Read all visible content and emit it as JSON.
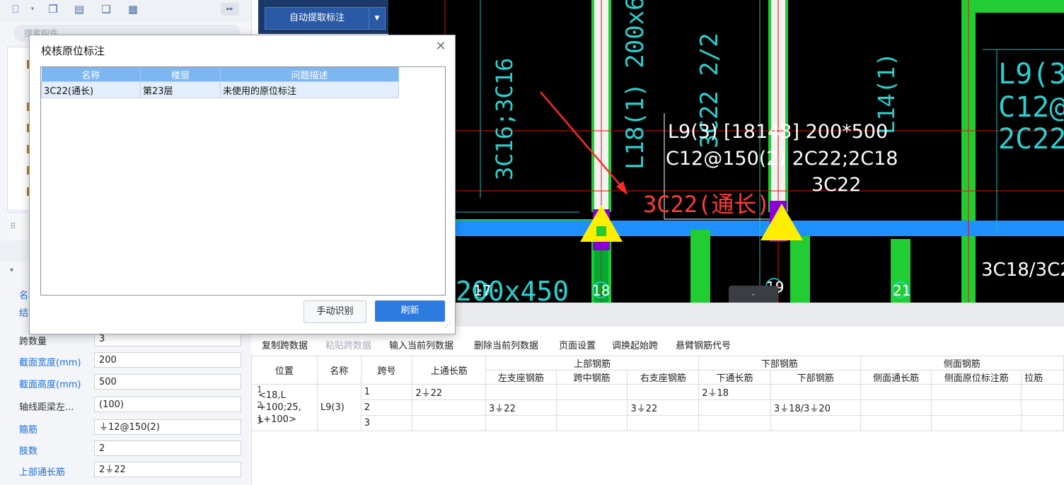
{
  "toolbar": {
    "icons": [
      "new-icon",
      "copy-icon",
      "delete-icon",
      "duplicate-icon",
      "layer-copy-icon",
      "more-icon"
    ]
  },
  "search": {
    "placeholder": "搜索构件"
  },
  "mid": {
    "auto_button": "自动提取标注"
  },
  "properties": {
    "rows": [
      {
        "label": "名称",
        "value": "",
        "blue": true
      },
      {
        "label": "结构类别",
        "value": "",
        "blue": true
      },
      {
        "label": "跨数量",
        "value": "3",
        "blue": false
      },
      {
        "label": "截面宽度(mm)",
        "value": "200",
        "blue": true
      },
      {
        "label": "截面高度(mm)",
        "value": "500",
        "blue": true
      },
      {
        "label": "轴线距梁左...",
        "value": "(100)",
        "blue": false
      },
      {
        "label": "箍筋",
        "value": "⏚12@150(2)",
        "blue": true
      },
      {
        "label": "肢数",
        "value": "2",
        "blue": true
      },
      {
        "label": "上部通长筋",
        "value": "2⏚22",
        "blue": true
      }
    ]
  },
  "dialog": {
    "title": "校核原位标注",
    "columns": [
      "名称",
      "楼层",
      "问题描述"
    ],
    "rows": [
      {
        "name": "3C22(通长)",
        "floor": "第23层",
        "problem": "未使用的原位标注"
      }
    ],
    "manual_button": "手动识别",
    "refresh_button": "刷新"
  },
  "cad": {
    "labels": {
      "beam_name": "L9(3) [18143] 200*500",
      "stirrup": "C12@150(2) 2C22;2C18",
      "top_bar": "3C22",
      "red_note": "3C22(通长)",
      "vert_1": "L18(1) 200x600",
      "vert_2": "3C22 2/2",
      "vert_3": "3C16;3C16",
      "vert_4": "L14(1)",
      "right_1": "L9(3",
      "right_2": "C12@",
      "right_3": "2C22",
      "bottom_1": "200x450",
      "axis_17": "17",
      "axis_18": "18",
      "axis_19": "19",
      "axis_21": "21",
      "bottom_right": "3C18/3C2"
    }
  },
  "grid_toolbar": {
    "buttons": [
      {
        "label": "复制跨数据",
        "disabled": false
      },
      {
        "label": "粘贴跨数据",
        "disabled": true
      },
      {
        "label": "输入当前列数据",
        "disabled": false
      },
      {
        "label": "删除当前列数据",
        "disabled": false
      },
      {
        "label": "页面设置",
        "disabled": false
      },
      {
        "label": "调换起始跨",
        "disabled": false
      },
      {
        "label": "悬臂钢筋代号",
        "disabled": false
      }
    ]
  },
  "span_table": {
    "group_headers": {
      "top": "上部钢筋",
      "bottom": "下部钢筋",
      "side": "侧面钢筋"
    },
    "headers": {
      "position": "位置",
      "name": "名称",
      "span": "跨号",
      "top_through": "上通长筋",
      "left_support": "左支座钢筋",
      "mid_span": "跨中钢筋",
      "right_support": "右支座钢筋",
      "bottom_through": "下通长筋",
      "bottom_bar": "下部钢筋",
      "side_through": "侧面通长筋",
      "side_in_place": "侧面原位标注筋",
      "tie": "拉筋"
    },
    "position_lines": [
      "<18,L",
      "+100;25,",
      "L+100>"
    ],
    "row_numbers": [
      "1",
      "2",
      "3"
    ],
    "name": "L9(3)",
    "rows": [
      {
        "span": "1",
        "top_through": "2⏚22",
        "left_support": "",
        "mid_span": "",
        "right_support": "",
        "bottom_through": "2⏚18",
        "bottom_bar": ""
      },
      {
        "span": "2",
        "top_through": "",
        "left_support": "3⏚22",
        "mid_span": "",
        "right_support": "3⏚22",
        "bottom_through": "",
        "bottom_bar": "3⏚18/3⏚20"
      },
      {
        "span": "3",
        "top_through": "",
        "left_support": "",
        "mid_span": "",
        "right_support": "",
        "bottom_through": "",
        "bottom_bar": ""
      }
    ]
  },
  "colors": {
    "cad_bg": "#000000",
    "beam_blue": "#1e90ff",
    "column_green": "#22cc33",
    "marker_yellow": "#ffee00",
    "marker_purple": "#8a00d4",
    "accent": "#2e7be0"
  }
}
